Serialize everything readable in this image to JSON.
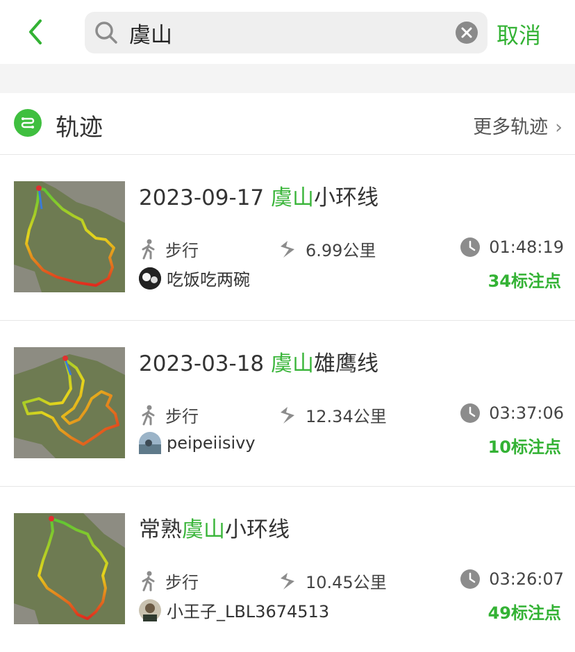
{
  "search": {
    "query": "虞山",
    "cancel_label": "取消"
  },
  "section": {
    "title": "轨迹",
    "more_label": "更多轨迹"
  },
  "colors": {
    "accent": "#33b234",
    "highlight": "#3ab53a"
  },
  "tracks": [
    {
      "title_prefix": "2023-09-17 ",
      "title_highlight": "虞山",
      "title_suffix": "小环线",
      "mode": "步行",
      "distance": "6.99公里",
      "duration": "01:48:19",
      "user": "吃饭吃两碗",
      "marks": "34标注点"
    },
    {
      "title_prefix": "2023-03-18 ",
      "title_highlight": "虞山",
      "title_suffix": "雄鹰线",
      "mode": "步行",
      "distance": "12.34公里",
      "duration": "03:37:06",
      "user": "peipeiisivy",
      "marks": "10标注点"
    },
    {
      "title_prefix": "常熟",
      "title_highlight": "虞山",
      "title_suffix": "小环线",
      "mode": "步行",
      "distance": "10.45公里",
      "duration": "03:26:07",
      "user": "小王子_LBL3674513",
      "marks": "49标注点"
    }
  ]
}
